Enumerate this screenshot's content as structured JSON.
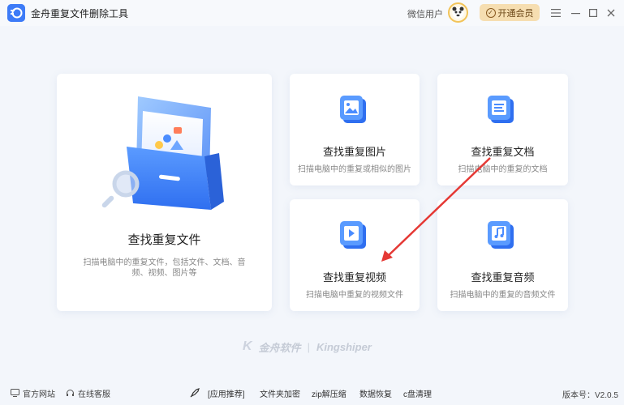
{
  "app": {
    "title": "金舟重复文件删除工具"
  },
  "header": {
    "user_name": "微信用户",
    "vip_label": "开通会员"
  },
  "cards": {
    "main": {
      "title": "查找重复文件",
      "desc": "扫描电脑中的重复文件，包括文件、文档、音频、视频、图片等"
    },
    "images": {
      "title": "查找重复图片",
      "desc": "扫描电脑中的重复或相似的图片"
    },
    "docs": {
      "title": "查找重复文档",
      "desc": "扫描电脑中的重复的文档"
    },
    "videos": {
      "title": "查找重复视频",
      "desc": "扫描电脑中重复的视频文件"
    },
    "audio": {
      "title": "查找重复音频",
      "desc": "扫描电脑中的重复的音频文件"
    }
  },
  "brand": {
    "cn": "金舟软件",
    "en": "Kingshiper"
  },
  "footer": {
    "website": "官方网站",
    "support": "在线客服",
    "recommend": "[应用推荐]",
    "links": [
      "文件夹加密",
      "zip解压缩",
      "数据恢复",
      "c盘清理"
    ],
    "version": "版本号：V2.0.5"
  },
  "colors": {
    "accent": "#3d7bf7",
    "vip_bg": "#f6deb1",
    "arrow": "#e53935"
  }
}
